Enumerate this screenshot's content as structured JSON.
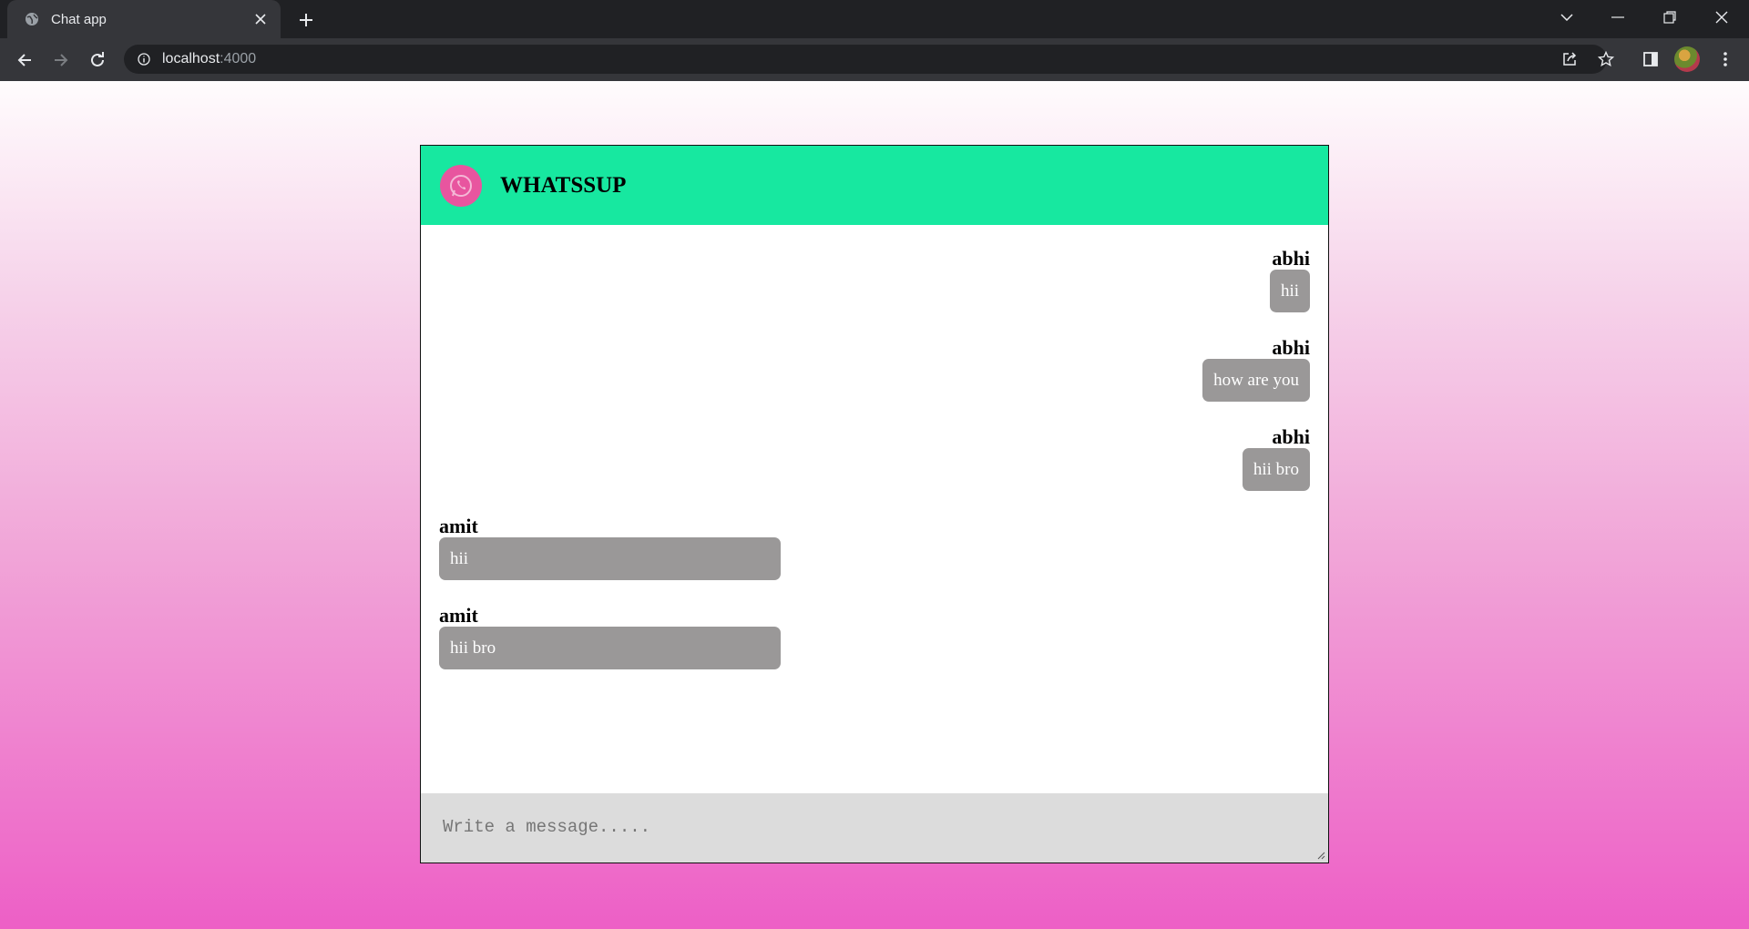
{
  "browser": {
    "tab_title": "Chat app",
    "url_host": "localhost",
    "url_port": ":4000"
  },
  "app": {
    "title": "WHATSSUP",
    "header_color": "#17e8a0",
    "logo_color": "#e8559f",
    "bubble_color": "#9a9898"
  },
  "messages": [
    {
      "sender": "abhi",
      "text": "hii",
      "side": "right"
    },
    {
      "sender": "abhi",
      "text": "how are you",
      "side": "right"
    },
    {
      "sender": "abhi",
      "text": "hii bro",
      "side": "right"
    },
    {
      "sender": "amit",
      "text": "hii",
      "side": "left"
    },
    {
      "sender": "amit",
      "text": "hii bro",
      "side": "left"
    }
  ],
  "composer": {
    "placeholder": "Write a message.....",
    "value": ""
  }
}
